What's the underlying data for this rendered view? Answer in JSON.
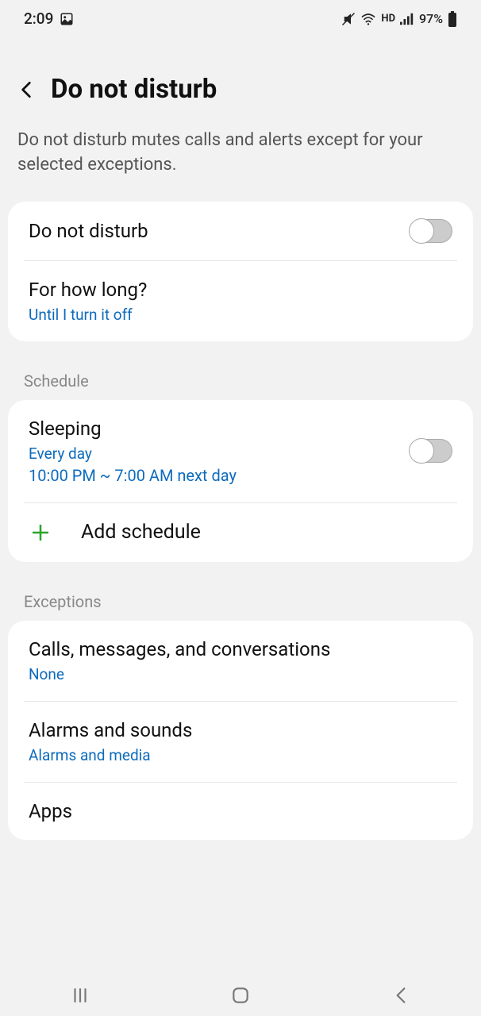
{
  "status": {
    "time": "2:09",
    "battery": "97%",
    "network_label": "HD"
  },
  "header": {
    "title": "Do not disturb"
  },
  "description": "Do not disturb mutes calls and alerts except for your selected exceptions.",
  "main": {
    "dnd_label": "Do not disturb",
    "duration_label": "For how long?",
    "duration_value": "Until I turn it off"
  },
  "schedule": {
    "section": "Schedule",
    "sleeping_label": "Sleeping",
    "sleeping_days": "Every day",
    "sleeping_time": "10:00 PM ~ 7:00 AM next day",
    "add_label": "Add schedule"
  },
  "exceptions": {
    "section": "Exceptions",
    "calls_label": "Calls, messages, and conversations",
    "calls_value": "None",
    "alarms_label": "Alarms and sounds",
    "alarms_value": "Alarms and media",
    "apps_label": "Apps"
  }
}
